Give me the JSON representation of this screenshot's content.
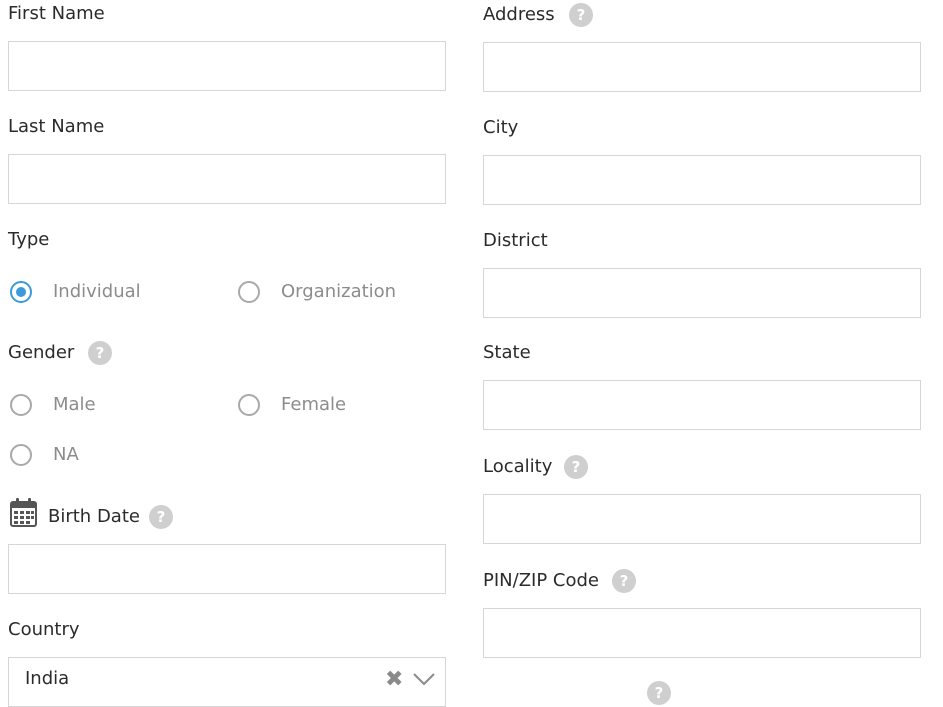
{
  "left": {
    "first_name": {
      "label": "First Name",
      "value": ""
    },
    "last_name": {
      "label": "Last Name",
      "value": ""
    },
    "type": {
      "label": "Type",
      "options": [
        "Individual",
        "Organization"
      ],
      "selected": "Individual"
    },
    "gender": {
      "label": "Gender",
      "options": [
        "Male",
        "Female",
        "NA"
      ]
    },
    "birth_date": {
      "label": "Birth Date",
      "value": ""
    },
    "country": {
      "label": "Country",
      "value": "India"
    }
  },
  "right": {
    "address": {
      "label": "Address",
      "value": ""
    },
    "city": {
      "label": "City",
      "value": ""
    },
    "district": {
      "label": "District",
      "value": ""
    },
    "state": {
      "label": "State",
      "value": ""
    },
    "locality": {
      "label": "Locality",
      "value": ""
    },
    "pin": {
      "label": "PIN/ZIP Code",
      "value": ""
    }
  },
  "help_symbol": "?",
  "clear_symbol": "✖",
  "colors": {
    "accent": "#3d9ad8",
    "help_bg": "#cfcfcf",
    "border": "#d6d6d6"
  }
}
